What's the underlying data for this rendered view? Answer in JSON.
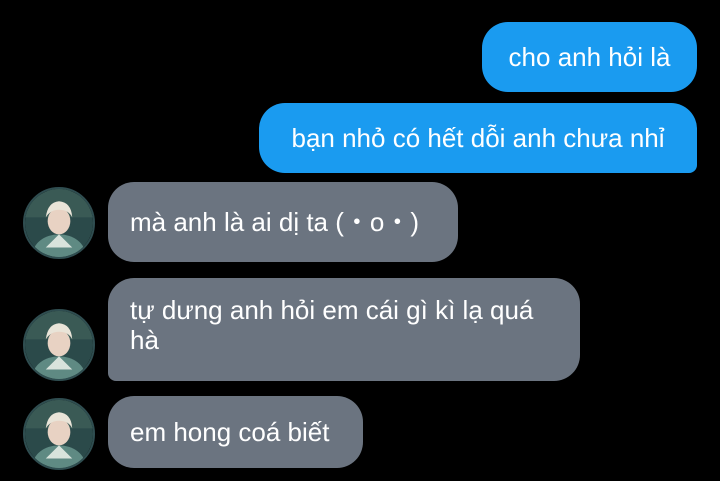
{
  "messages": {
    "outgoing": [
      {
        "text": "cho anh hỏi là"
      },
      {
        "text": "bạn nhỏ có hết dỗi anh chưa nhỉ"
      }
    ],
    "incoming": [
      {
        "text": "mà anh là ai dị ta (・o・)"
      },
      {
        "text": "tự dưng anh hỏi em cái gì kì lạ quá hà"
      },
      {
        "text": "em hong coá biết"
      }
    ]
  },
  "colors": {
    "background": "#000000",
    "outgoing_bubble": "#1a9bf0",
    "incoming_bubble": "#6b7480",
    "text": "#ffffff"
  },
  "icons": {
    "avatar": "contact-avatar-photo"
  }
}
